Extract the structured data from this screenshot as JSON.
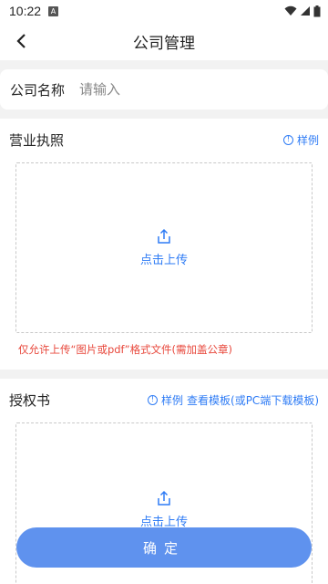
{
  "status": {
    "time": "10:22",
    "a_icon": "A"
  },
  "nav": {
    "title": "公司管理"
  },
  "company": {
    "label": "公司名称",
    "placeholder": "请输入",
    "value": ""
  },
  "license": {
    "title": "营业执照",
    "example": "样例",
    "upload_label": "点击上传",
    "hint": "仅允许上传“图片或pdf”格式文件(需加盖公章)"
  },
  "authorization": {
    "title": "授权书",
    "example": "样例",
    "template": "查看模板(或PC端下载模板)",
    "upload_label": "点击上传"
  },
  "confirm_label": "确定",
  "colors": {
    "accent": "#2f7cf5",
    "button": "#5f92ee",
    "warning": "#e8483c"
  }
}
